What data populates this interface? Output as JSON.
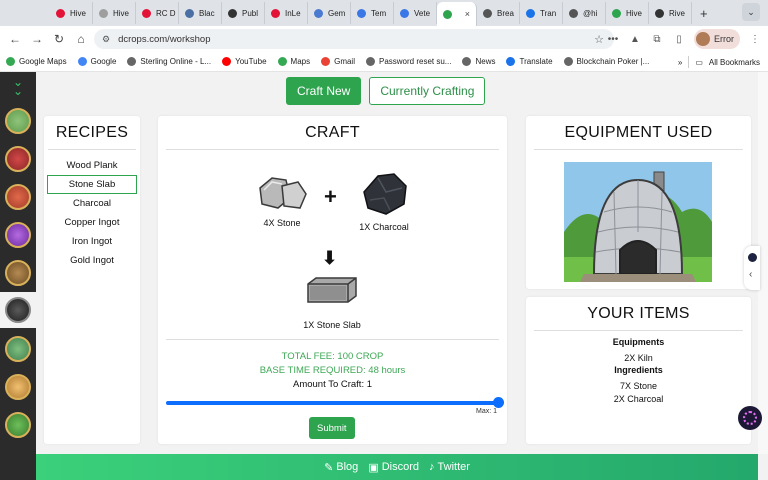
{
  "browser": {
    "tabs": [
      {
        "label": "Hive",
        "color": "#e31337"
      },
      {
        "label": "Hive",
        "color": "#9e9e9e"
      },
      {
        "label": "RC D",
        "color": "#e31337"
      },
      {
        "label": "Blac",
        "color": "#4a6fa5"
      },
      {
        "label": "Publ",
        "color": "#333333"
      },
      {
        "label": "InLe",
        "color": "#e31337"
      },
      {
        "label": "Gem",
        "color": "#4a7bd0"
      },
      {
        "label": "Tem",
        "color": "#3b78e7"
      },
      {
        "label": "Vete",
        "color": "#3b78e7"
      },
      {
        "label": "",
        "color": "#2ea44f",
        "active": true
      },
      {
        "label": "Brea",
        "color": "#555555"
      },
      {
        "label": "Tran",
        "color": "#1a73e8"
      },
      {
        "label": "@hi",
        "color": "#555555"
      },
      {
        "label": "Hive",
        "color": "#2ea44f"
      },
      {
        "label": "Rive",
        "color": "#333333"
      }
    ],
    "tab_close": "×",
    "new_tab": "+",
    "url": "dcrops.com/workshop",
    "profile_label": "Error",
    "bookmarks": [
      {
        "label": "Google Maps",
        "color": "#34a853"
      },
      {
        "label": "Google",
        "color": "#4285f4"
      },
      {
        "label": "Sterling Online - L...",
        "color": "#666666"
      },
      {
        "label": "YouTube",
        "color": "#ff0000"
      },
      {
        "label": "Maps",
        "color": "#34a853"
      },
      {
        "label": "Gmail",
        "color": "#ea4335"
      },
      {
        "label": "Password reset su...",
        "color": "#666666"
      },
      {
        "label": "News",
        "color": "#666666"
      },
      {
        "label": "Translate",
        "color": "#1a73e8"
      },
      {
        "label": "Blockchain Poker |...",
        "color": "#666666"
      }
    ],
    "bookmarks_more": "»",
    "all_bookmarks": "All Bookmarks"
  },
  "header": {
    "craft_new": "Craft New",
    "currently_crafting": "Currently Crafting"
  },
  "recipes": {
    "title": "RECIPES",
    "items": [
      "Wood Plank",
      "Stone Slab",
      "Charcoal",
      "Copper Ingot",
      "Iron Ingot",
      "Gold Ingot"
    ],
    "active_index": 1
  },
  "craft": {
    "title": "CRAFT",
    "input1": "4X Stone",
    "input2": "1X Charcoal",
    "output": "1X Stone Slab",
    "total_fee": "TOTAL FEE: 100 CROP",
    "base_time": "BASE TIME REQUIRED: 48 hours",
    "amount": "Amount To Craft: 1",
    "slider_fraction": 1.0,
    "max_label": "Max: 1",
    "submit": "Submit"
  },
  "equipment": {
    "title": "EQUIPMENT USED"
  },
  "your_items": {
    "title": "YOUR ITEMS",
    "equipments_heading": "Equipments",
    "equipments": [
      "2X Kiln"
    ],
    "ingredients_heading": "Ingredients",
    "ingredients": [
      "7X Stone",
      "2X Charcoal"
    ]
  },
  "footer": {
    "blog": "Blog",
    "discord": "Discord",
    "twitter": "Twitter"
  },
  "colors": {
    "accent_green": "#2ea44f",
    "fee_green": "#3ea856",
    "slider_blue": "#0d6efd",
    "sidebar_dark": "#2b2b2b"
  }
}
